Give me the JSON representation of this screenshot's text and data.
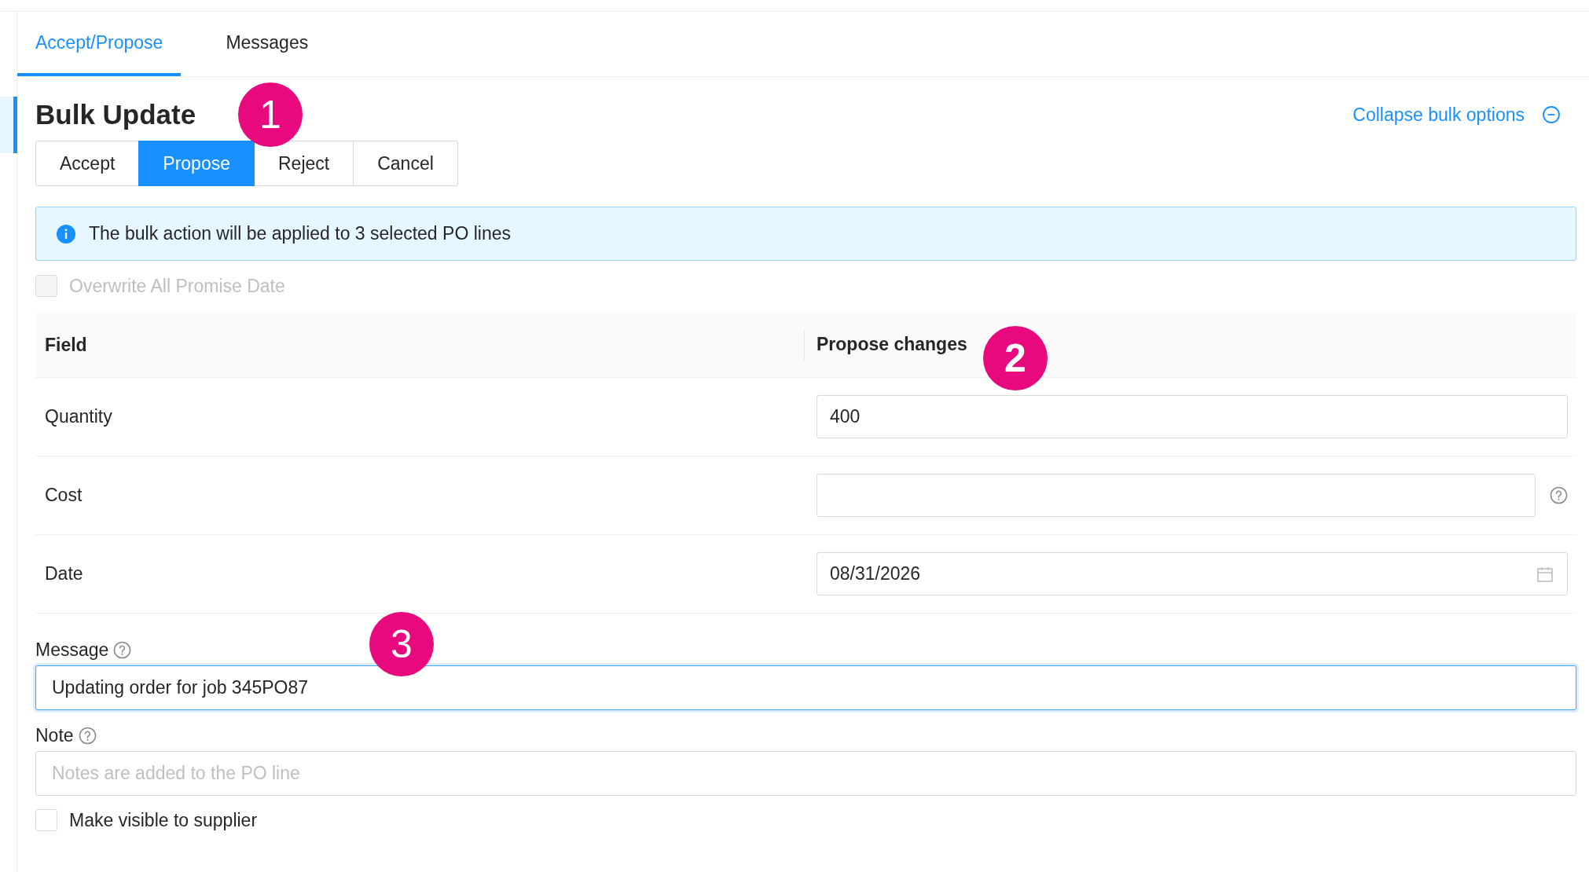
{
  "tabs": [
    {
      "label": "Accept/Propose",
      "selected": true
    },
    {
      "label": "Messages",
      "selected": false
    }
  ],
  "bulk_update": {
    "title": "Bulk Update",
    "collapse_link": "Collapse bulk options",
    "actions": [
      {
        "label": "Accept",
        "selected": false
      },
      {
        "label": "Propose",
        "selected": true
      },
      {
        "label": "Reject",
        "selected": false
      },
      {
        "label": "Cancel",
        "selected": false
      }
    ],
    "info_banner": "The bulk action will be applied to 3 selected PO lines",
    "overwrite_checkbox": {
      "label": "Overwrite All Promise Date",
      "checked": false,
      "disabled": true
    },
    "table": {
      "columns": [
        "Field",
        "Propose changes"
      ],
      "rows": [
        {
          "field": "Quantity",
          "kind": "text",
          "value": "400"
        },
        {
          "field": "Cost",
          "kind": "help"
        },
        {
          "field": "Date",
          "kind": "date",
          "value": "08/31/2026"
        }
      ]
    },
    "message": {
      "label": "Message",
      "value": "Updating order for job 345PO87",
      "focused": true
    },
    "note": {
      "label": "Note",
      "placeholder": "Notes are added to the PO line",
      "focused": false
    },
    "visible_checkbox": {
      "label": "Make visible to supplier",
      "checked": false,
      "disabled": false
    }
  },
  "callouts": [
    {
      "number": "1"
    },
    {
      "number": "2"
    },
    {
      "number": "3"
    }
  ]
}
